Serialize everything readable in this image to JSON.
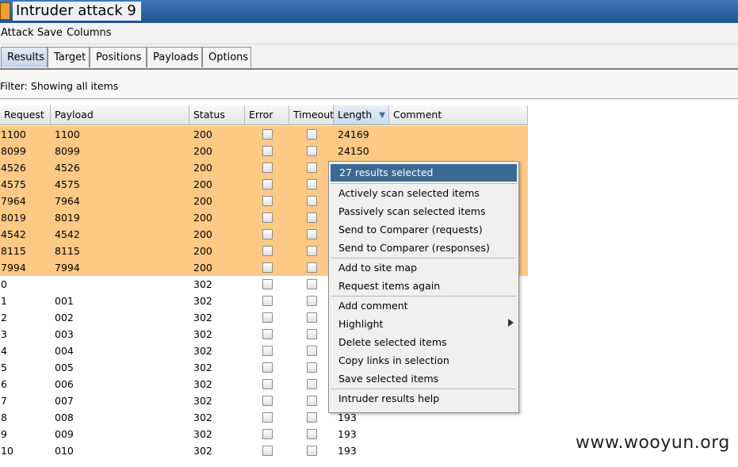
{
  "window": {
    "title": "Intruder attack 9"
  },
  "menu": [
    "Attack",
    "Save",
    "Columns"
  ],
  "tabs": [
    {
      "label": "Results",
      "active": true
    },
    {
      "label": "Target",
      "active": false
    },
    {
      "label": "Positions",
      "active": false
    },
    {
      "label": "Payloads",
      "active": false
    },
    {
      "label": "Options",
      "active": false
    }
  ],
  "filter": {
    "text": "Filter:  Showing all items"
  },
  "table": {
    "columns": [
      "Request",
      "Payload",
      "Status",
      "Error",
      "Timeout",
      "Length",
      "Comment"
    ],
    "sorted_column": "Length",
    "highlight_color": "#fdc985",
    "rows": [
      {
        "request": "1100",
        "payload": "1100",
        "status": "200",
        "length": "24169",
        "highlighted": true
      },
      {
        "request": "8099",
        "payload": "8099",
        "status": "200",
        "length": "24150",
        "highlighted": true
      },
      {
        "request": "4526",
        "payload": "4526",
        "status": "200",
        "length": "",
        "highlighted": true
      },
      {
        "request": "4575",
        "payload": "4575",
        "status": "200",
        "length": "",
        "highlighted": true
      },
      {
        "request": "7964",
        "payload": "7964",
        "status": "200",
        "length": "",
        "highlighted": true
      },
      {
        "request": "8019",
        "payload": "8019",
        "status": "200",
        "length": "",
        "highlighted": true
      },
      {
        "request": "4542",
        "payload": "4542",
        "status": "200",
        "length": "",
        "highlighted": true
      },
      {
        "request": "8115",
        "payload": "8115",
        "status": "200",
        "length": "",
        "highlighted": true
      },
      {
        "request": "7994",
        "payload": "7994",
        "status": "200",
        "length": "",
        "highlighted": true
      },
      {
        "request": "0",
        "payload": "",
        "status": "302",
        "length": "",
        "highlighted": false
      },
      {
        "request": "1",
        "payload": "001",
        "status": "302",
        "length": "",
        "highlighted": false
      },
      {
        "request": "2",
        "payload": "002",
        "status": "302",
        "length": "",
        "highlighted": false
      },
      {
        "request": "3",
        "payload": "003",
        "status": "302",
        "length": "",
        "highlighted": false
      },
      {
        "request": "4",
        "payload": "004",
        "status": "302",
        "length": "",
        "highlighted": false
      },
      {
        "request": "5",
        "payload": "005",
        "status": "302",
        "length": "",
        "highlighted": false
      },
      {
        "request": "6",
        "payload": "006",
        "status": "302",
        "length": "",
        "highlighted": false
      },
      {
        "request": "7",
        "payload": "007",
        "status": "302",
        "length": "",
        "highlighted": false
      },
      {
        "request": "8",
        "payload": "008",
        "status": "302",
        "length": "193",
        "highlighted": false
      },
      {
        "request": "9",
        "payload": "009",
        "status": "302",
        "length": "193",
        "highlighted": false
      },
      {
        "request": "10",
        "payload": "010",
        "status": "302",
        "length": "193",
        "highlighted": false
      }
    ]
  },
  "context_menu": {
    "header": "27 results selected",
    "groups": [
      [
        "Actively scan selected items",
        "Passively scan selected items",
        "Send to Comparer (requests)",
        "Send to Comparer (responses)"
      ],
      [
        "Add to site map",
        "Request items again"
      ],
      [
        "Add comment",
        "Highlight",
        "Delete selected items",
        "Copy links in selection",
        "Save selected items"
      ],
      [
        "Intruder results help"
      ]
    ]
  },
  "watermark": "www.wooyun.org"
}
